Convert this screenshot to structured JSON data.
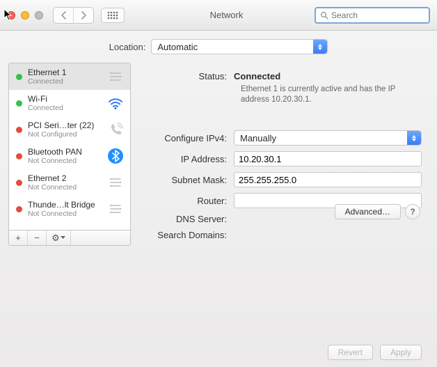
{
  "window": {
    "title": "Network"
  },
  "search": {
    "placeholder": "Search"
  },
  "location": {
    "label": "Location:",
    "value": "Automatic"
  },
  "sidebar": {
    "items": [
      {
        "name": "Ethernet 1",
        "status": "Connected",
        "dot": "green",
        "selected": true,
        "icon": "ethernet"
      },
      {
        "name": "Wi-Fi",
        "status": "Connected",
        "dot": "green",
        "selected": false,
        "icon": "wifi"
      },
      {
        "name": "PCI Seri…ter (22)",
        "status": "Not Configured",
        "dot": "red",
        "selected": false,
        "icon": "phone"
      },
      {
        "name": "Bluetooth PAN",
        "status": "Not Connected",
        "dot": "red",
        "selected": false,
        "icon": "bluetooth"
      },
      {
        "name": "Ethernet 2",
        "status": "Not Connected",
        "dot": "red",
        "selected": false,
        "icon": "ethernet"
      },
      {
        "name": "Thunde…lt Bridge",
        "status": "Not Connected",
        "dot": "red",
        "selected": false,
        "icon": "ethernet"
      }
    ],
    "toolbar": {
      "plus": "+",
      "minus": "−",
      "gear": "⚙︎"
    }
  },
  "detail": {
    "status_label": "Status:",
    "status_value": "Connected",
    "status_desc": "Ethernet 1 is currently active and has the IP address 10.20.30.1.",
    "configure_label": "Configure IPv4:",
    "configure_value": "Manually",
    "ip_label": "IP Address:",
    "ip_value": "10.20.30.1",
    "subnet_label": "Subnet Mask:",
    "subnet_value": "255.255.255.0",
    "router_label": "Router:",
    "router_value": "",
    "dns_label": "DNS Server:",
    "search_domains_label": "Search Domains:",
    "advanced_label": "Advanced…",
    "help": "?",
    "revert_label": "Revert",
    "apply_label": "Apply"
  }
}
